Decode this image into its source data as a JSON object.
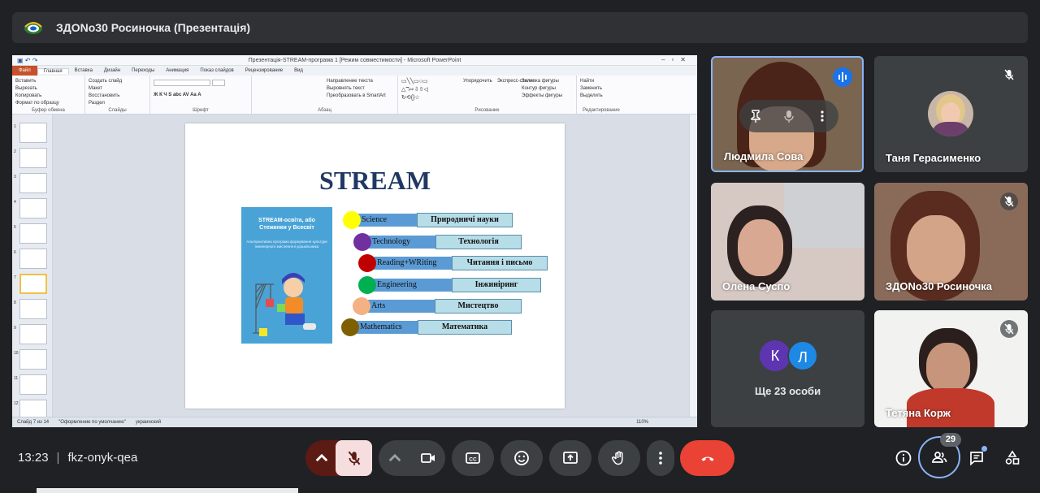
{
  "meeting": {
    "title": "ЗДОNo30 Росиночка (Презентація)",
    "time": "13:23",
    "code": "fkz-onyk-qea",
    "participant_count": "29"
  },
  "powerpoint": {
    "window_title": "Презентація-STREAM-програма 1 [Режим совместимости] - Microsoft PowerPoint",
    "tabs": [
      "Файл",
      "Главная",
      "Вставка",
      "Дизайн",
      "Переходы",
      "Анимация",
      "Показ слайдов",
      "Рецензирование",
      "Вид"
    ],
    "ribbon": {
      "clipboard": [
        "Вставить",
        "Вырезать",
        "Копировать",
        "Формат по образцу"
      ],
      "clipboard_cap": "Буфер обмена",
      "slides": [
        "Создать слайд",
        "Макет",
        "Восстановить",
        "Раздел"
      ],
      "slides_cap": "Слайды",
      "font_cap": "Шрифт",
      "paragraph": [
        "Направление текста",
        "Выровнять текст",
        "Преобразовать в SmartArt"
      ],
      "paragraph_cap": "Абзац",
      "drawing": [
        "Упорядочить",
        "Экспресс-стили",
        "Заливка фигуры",
        "Контур фигуры",
        "Эффекты фигуры"
      ],
      "drawing_cap": "Рисование",
      "editing": [
        "Найти",
        "Заменить",
        "Выделить"
      ],
      "editing_cap": "Редактирование"
    },
    "thumb_numbers": [
      "1",
      "2",
      "3",
      "4",
      "5",
      "6",
      "7",
      "8",
      "9",
      "10",
      "11",
      "12"
    ],
    "status": [
      "Слайд 7 из 14",
      "\"Оформление по умолчанию\"",
      "украинский"
    ],
    "zoom": "110%",
    "slide": {
      "title": "STREAM",
      "book_title": "STREAM-освіта, або Стежинки у Всесвіт",
      "book_subtitle": "Альтернативна програма формування культури інженерного мислення в дошкільника",
      "rows": [
        {
          "en": "Science",
          "uk": "Природничі  науки",
          "color": "#ffff00"
        },
        {
          "en": "Technology",
          "uk": "Технологія",
          "color": "#7030a0"
        },
        {
          "en": "Reading+WRiting",
          "uk": "Читання і письмо",
          "color": "#c00000"
        },
        {
          "en": "Engineering",
          "uk": "Інжиніринг",
          "color": "#00b050"
        },
        {
          "en": "Arts",
          "uk": "Мистецтво",
          "color": "#f4b183"
        },
        {
          "en": "Mathematics",
          "uk": "Математика",
          "color": "#7f6000"
        }
      ]
    }
  },
  "participants": [
    {
      "name": "Людмила Сова"
    },
    {
      "name": "Таня Герасименко"
    },
    {
      "name": "Олена Суспо"
    },
    {
      "name": "ЗДОNo30 Росиночка"
    },
    {
      "name": "Ще 23 особи",
      "initials": [
        "К",
        "Л"
      ]
    },
    {
      "name": "Тетяна Корж"
    }
  ]
}
